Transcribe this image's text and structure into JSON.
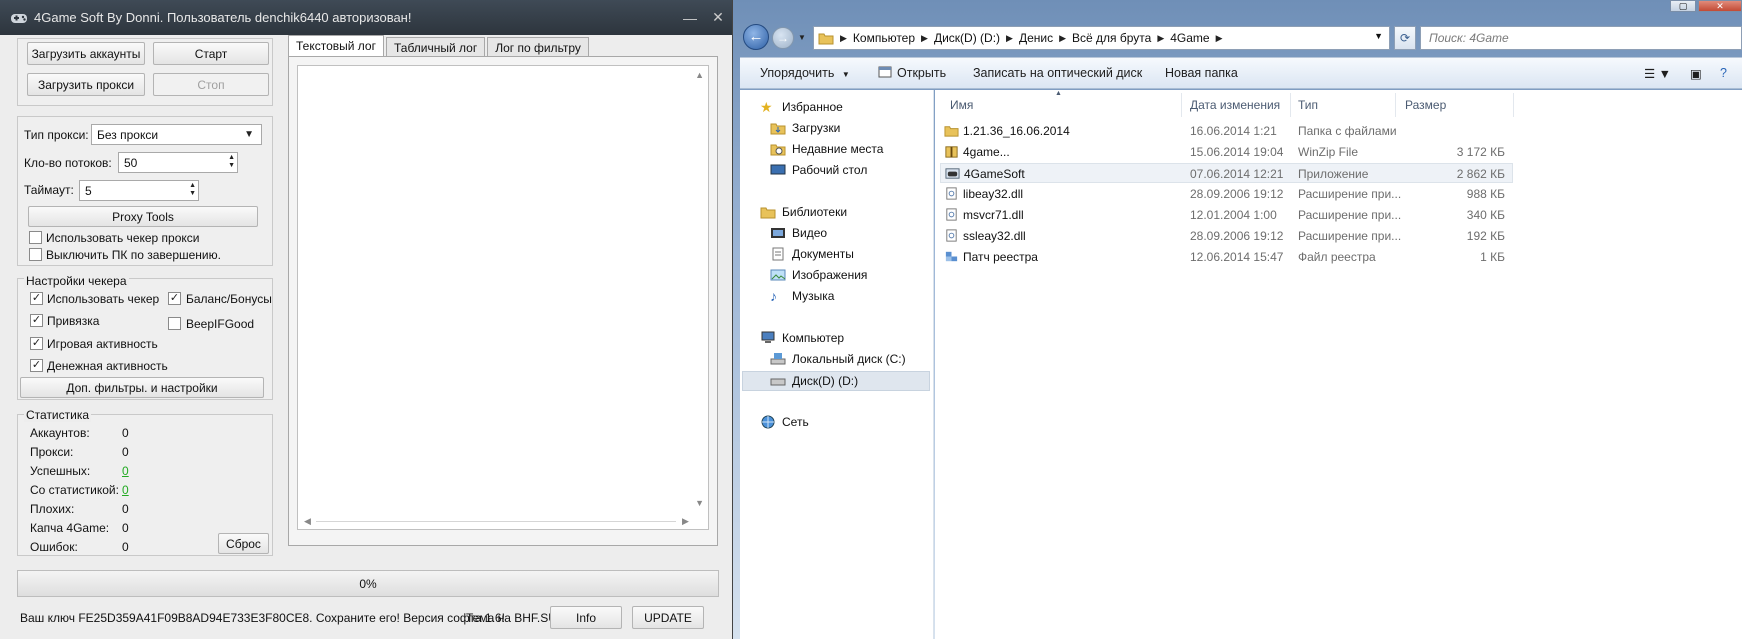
{
  "app": {
    "title": "4Game Soft By Donni. Пользователь denchik6440 авторизован!",
    "buttons": {
      "load_accounts": "Загрузить аккаунты",
      "start": "Старт",
      "load_proxy": "Загрузить прокси",
      "stop": "Стоп",
      "proxy_tools": "Proxy Tools",
      "extra_filters": "Доп. фильтры. и настройки",
      "reset": "Сброс",
      "info": "Info",
      "update": "UPDATE"
    },
    "settings": {
      "proxy_type_label": "Тип прокси:",
      "proxy_type_value": "Без прокси",
      "threads_label": "Кло-во потоков:",
      "threads_value": "50",
      "timeout_label": "Таймаут:",
      "timeout_value": "5",
      "use_proxy_checker": "Использовать чекер прокси",
      "shutdown_pc": "Выключить ПК по завершению."
    },
    "checker": {
      "title": "Настройки чекера",
      "use_checker": "Использовать чекер",
      "balance_bonus": "Баланс/Бонусы",
      "binding": "Привязка",
      "beep_if_good": "BeepIFGood",
      "game_activity": "Игровая активность",
      "money_activity": "Денежная активность"
    },
    "stats": {
      "title": "Статистика",
      "rows": [
        {
          "label": "Аккаунтов:",
          "value": "0"
        },
        {
          "label": "Прокси:",
          "value": "0"
        },
        {
          "label": "Успешных:",
          "value": "0"
        },
        {
          "label": "Со статистикой:",
          "value": "0"
        },
        {
          "label": "Плохих:",
          "value": "0"
        },
        {
          "label": "Капча 4Game:",
          "value": "0"
        },
        {
          "label": "Ошибок:",
          "value": "0"
        }
      ]
    },
    "tabs": [
      "Текстовый лог",
      "Табличный лог",
      "Лог по фильтру"
    ],
    "progress_text": "0%",
    "progress_fraction": 0,
    "footer_key": "Ваш ключ FE25D359A41F09B8AD94E733E3F80CE8. Сохраните его! Версия софта 1.6!",
    "footer_theme": "Тема на BHF.SU"
  },
  "explorer": {
    "breadcrumb": [
      "Компьютер",
      "Диск(D) (D:)",
      "Денис",
      "Всё для брута",
      "4Game"
    ],
    "search_placeholder": "Поиск: 4Game",
    "toolbar": {
      "organize": "Упорядочить",
      "open": "Открыть",
      "burn": "Записать на оптический диск",
      "new_folder": "Новая папка"
    },
    "nav": {
      "favorites": "Избранное",
      "downloads": "Загрузки",
      "recent": "Недавние места",
      "desktop": "Рабочий стол",
      "libraries": "Библиотеки",
      "video": "Видео",
      "documents": "Документы",
      "images": "Изображения",
      "music": "Музыка",
      "computer": "Компьютер",
      "local_disk": "Локальный диск (C:)",
      "disk_d": "Диск(D) (D:)",
      "network": "Сеть"
    },
    "columns": {
      "name": "Имя",
      "date": "Дата изменения",
      "type": "Тип",
      "size": "Размер"
    },
    "files": [
      {
        "name": "1.21.36_16.06.2014",
        "date": "16.06.2014 1:21",
        "type": "Папка с файлами",
        "size": "",
        "icon": "folder-icon"
      },
      {
        "name": "4game...",
        "date": "15.06.2014 19:04",
        "type": "WinZip File",
        "size": "3 172 КБ",
        "icon": "archive-icon"
      },
      {
        "name": "4GameSoft",
        "date": "07.06.2014 12:21",
        "type": "Приложение",
        "size": "2 862 КБ",
        "icon": "app-icon"
      },
      {
        "name": "libeay32.dll",
        "date": "28.09.2006 19:12",
        "type": "Расширение при...",
        "size": "988 КБ",
        "icon": "dll-icon"
      },
      {
        "name": "msvcr71.dll",
        "date": "12.01.2004 1:00",
        "type": "Расширение при...",
        "size": "340 КБ",
        "icon": "dll-icon"
      },
      {
        "name": "ssleay32.dll",
        "date": "28.09.2006 19:12",
        "type": "Расширение при...",
        "size": "192 КБ",
        "icon": "dll-icon"
      },
      {
        "name": "Патч реестра",
        "date": "12.06.2014 15:47",
        "type": "Файл реестра",
        "size": "1 КБ",
        "icon": "registry-icon"
      }
    ]
  }
}
